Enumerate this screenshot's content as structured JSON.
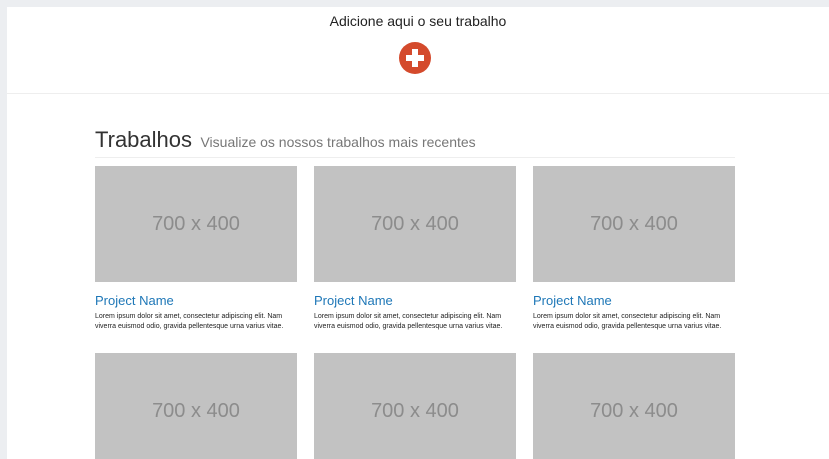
{
  "add_section": {
    "title": "Adicione aqui o seu trabalho",
    "add_icon": "plus-circle-icon",
    "accent_color": "#d44a2c"
  },
  "works": {
    "title": "Trabalhos",
    "subtitle": "Visualize os nossos trabalhos mais recentes",
    "link_color": "#1e77b7",
    "items": [
      {
        "image_label": "700 x 400",
        "name": "Project Name",
        "description": "Lorem ipsum dolor sit amet, consectetur adipiscing elit. Nam viverra euismod odio, gravida pellentesque urna varius vitae."
      },
      {
        "image_label": "700 x 400",
        "name": "Project Name",
        "description": "Lorem ipsum dolor sit amet, consectetur adipiscing elit. Nam viverra euismod odio, gravida pellentesque urna varius vitae."
      },
      {
        "image_label": "700 x 400",
        "name": "Project Name",
        "description": "Lorem ipsum dolor sit amet, consectetur adipiscing elit. Nam viverra euismod odio, gravida pellentesque urna varius vitae."
      },
      {
        "image_label": "700 x 400"
      },
      {
        "image_label": "700 x 400"
      },
      {
        "image_label": "700 x 400"
      }
    ]
  }
}
